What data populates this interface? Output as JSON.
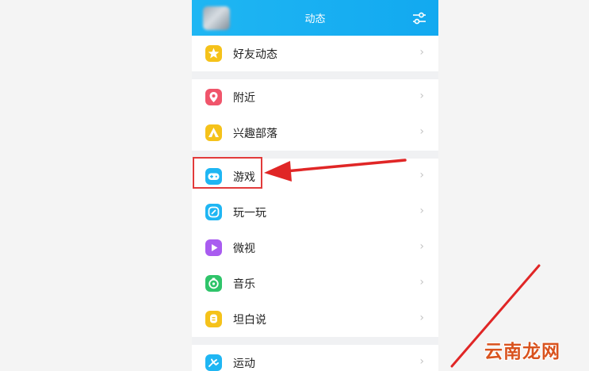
{
  "header": {
    "title": "动态",
    "accent": "#1fb6f3"
  },
  "items": [
    {
      "label": "好友动态",
      "icon": "star-icon",
      "color": "#f5c21a"
    },
    {
      "label": "附近",
      "icon": "location-pin-icon",
      "color": "#f0556b"
    },
    {
      "label": "兴趣部落",
      "icon": "tent-icon",
      "color": "#f5c21a"
    },
    {
      "label": "游戏",
      "icon": "gamepad-icon",
      "color": "#1fb6f3"
    },
    {
      "label": "玩一玩",
      "icon": "play-leaf-icon",
      "color": "#1fb6f3"
    },
    {
      "label": "微视",
      "icon": "video-play-icon",
      "color": "#a95cf0"
    },
    {
      "label": "音乐",
      "icon": "music-disc-icon",
      "color": "#2fc46a"
    },
    {
      "label": "坦白说",
      "icon": "chat-bubble-icon",
      "color": "#f5c21a"
    },
    {
      "label": "运动",
      "icon": "running-icon",
      "color": "#1fb6f3"
    }
  ],
  "chevron": "›",
  "annotation": {
    "highlight_color": "#e23b3b"
  },
  "watermark": "云南龙网"
}
